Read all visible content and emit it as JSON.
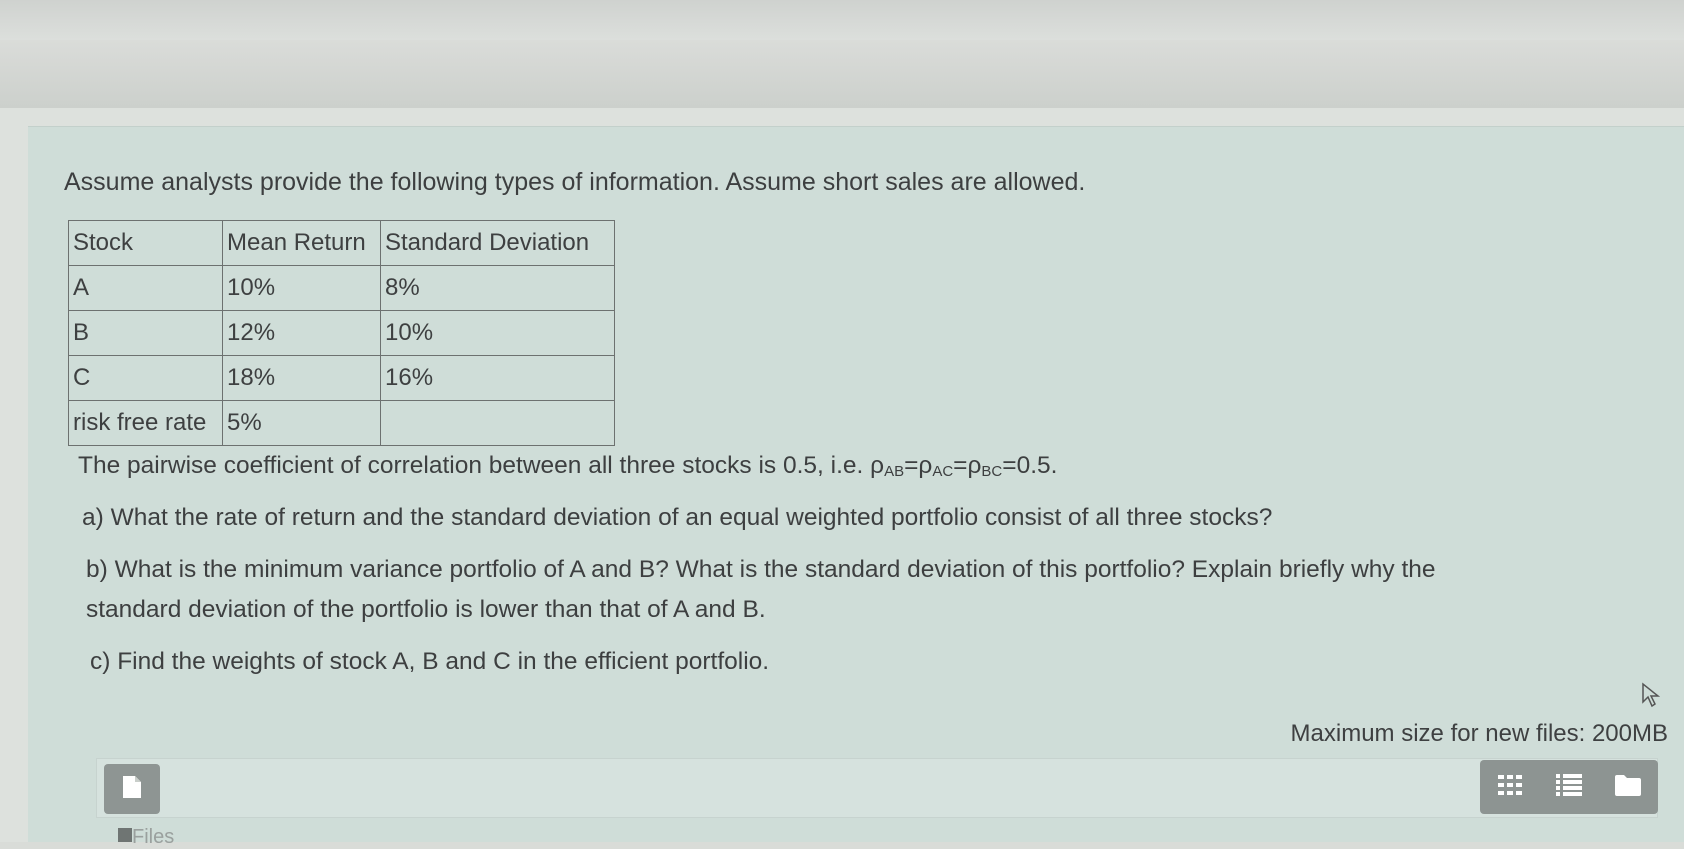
{
  "question": {
    "intro": "Assume analysts provide the following types of information. Assume short sales are allowed.",
    "table": {
      "headers": [
        "Stock",
        "Mean Return",
        "Standard Deviation"
      ],
      "rows": [
        [
          "A",
          "10%",
          "8%"
        ],
        [
          "B",
          "12%",
          "10%"
        ],
        [
          "C",
          "18%",
          "16%"
        ],
        [
          "risk free rate",
          "5%",
          ""
        ]
      ]
    },
    "correlation_text": "The pairwise coefficient of correlation between all three stocks is 0.5, i.e. ",
    "rho_symbol": "ρ",
    "rho_ab_sub": "AB",
    "rho_ac_sub": "AC",
    "rho_bc_sub": "BC",
    "eq": "=",
    "correlation_value": "0.5.",
    "part_a": "a) What the rate of return and the standard deviation of an equal weighted portfolio consist of all three stocks?",
    "part_b_line1": "b) What is the minimum variance portfolio of A and B? What is the standard deviation of this portfolio? Explain briefly why the",
    "part_b_line2": "standard deviation of the portfolio is lower than that of A and B.",
    "part_c": "c) Find the weights of stock A, B and C in the efficient portfolio."
  },
  "upload": {
    "max_size_text": "Maximum size for new files: 200MB",
    "files_label": "Files",
    "icons": {
      "add_file": "file-icon",
      "grid_view": "grid-view-icon",
      "list_view": "list-view-icon",
      "tree_view": "folder-icon"
    }
  }
}
